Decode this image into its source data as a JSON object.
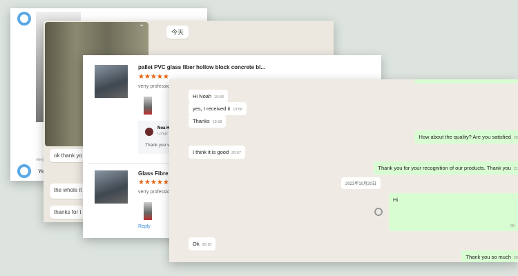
{
  "card_a": {
    "name_label": "veeja",
    "message": "Ye",
    "header": "..."
  },
  "card_b": {
    "date_pill": "今天",
    "messages": [
      "ok thank yo",
      "the whole it",
      "thanks for t"
    ]
  },
  "card_c": {
    "reviews": [
      {
        "title": "pallet PVC glass fiber hollow block concrete bl...",
        "stars": "★★★★★",
        "text": "verry professio",
        "reply_name": "Noa H",
        "reply_loc": "Longx",
        "reply_text": "Thank you v"
      },
      {
        "title": "Glass Fibre G",
        "stars": "★★★★★",
        "text": "verry professio",
        "reply_link": "Reply"
      }
    ]
  },
  "chat": {
    "messages": [
      {
        "text": "Hi Noah",
        "time": "19:58",
        "dir": "in"
      },
      {
        "text": "yes, I received it",
        "time": "19:58",
        "dir": "in"
      },
      {
        "text": "Thanks",
        "time": "19:58",
        "dir": "in"
      },
      {
        "text": "How about the quality? Are you satisfied",
        "time": "20",
        "dir": "out"
      },
      {
        "text": "I think it is good",
        "time": "20:07",
        "dir": "in"
      },
      {
        "text": "Thank you for your recognition of our products. Thank you",
        "time": "21",
        "dir": "out"
      },
      {
        "text": "Hi",
        "time": "09",
        "dir": "out"
      },
      {
        "text": "Ok",
        "time": "20:10",
        "dir": "in"
      },
      {
        "text": "Thank you so much",
        "time": "20",
        "dir": "out"
      }
    ],
    "date_divider": "2023年10月20日"
  }
}
